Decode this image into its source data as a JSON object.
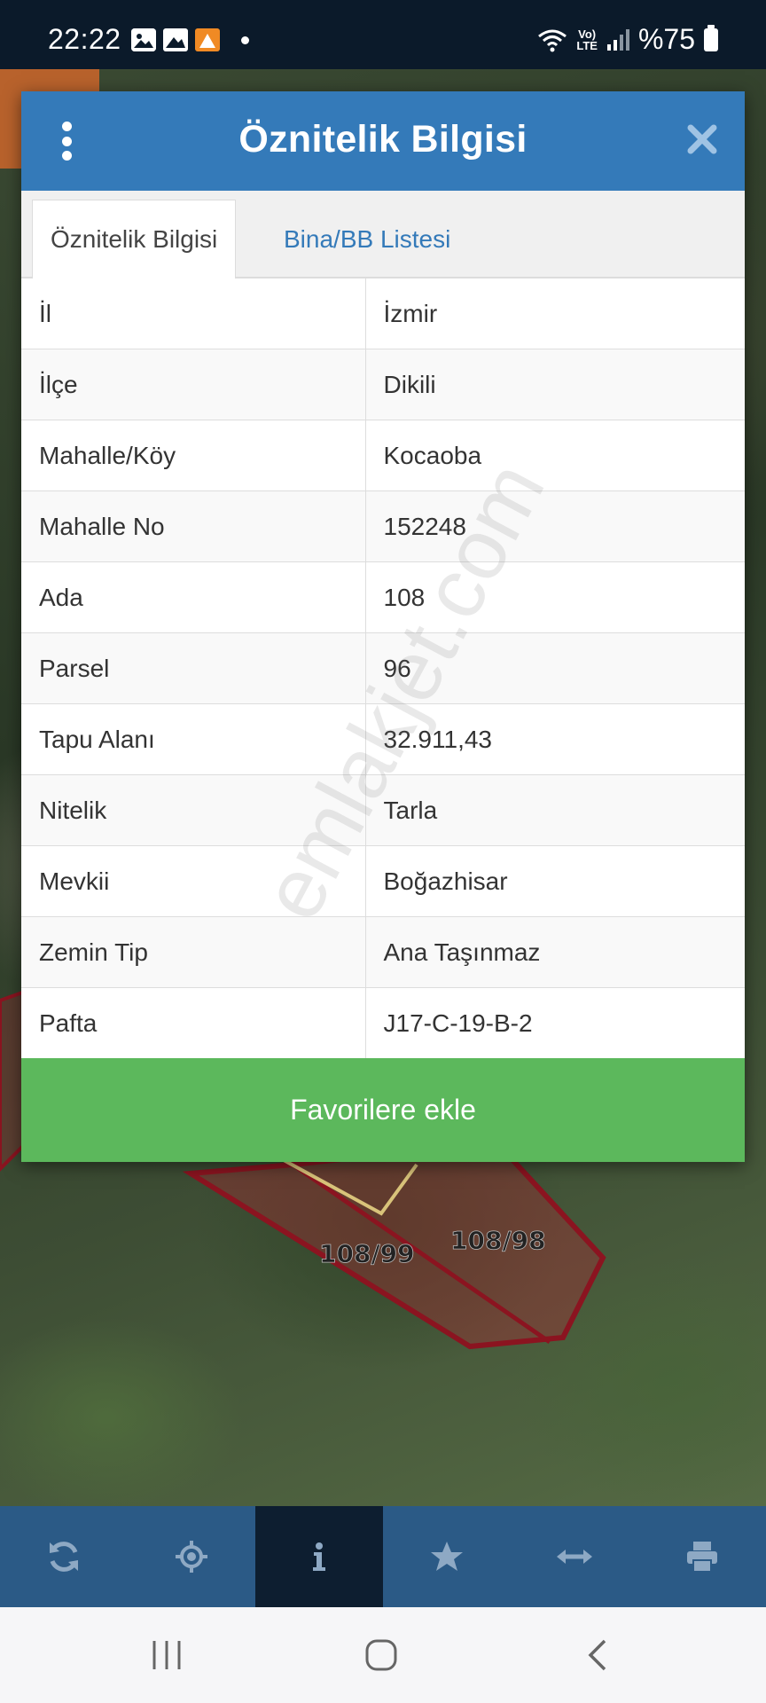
{
  "status_bar": {
    "time": "22:22",
    "lte_top": "Vo)",
    "lte_bottom": "LTE",
    "battery": "%75",
    "icons": [
      "gallery-icon",
      "image-icon",
      "app-icon",
      "notification-dot-icon",
      "wifi-icon",
      "signal-icon",
      "battery-icon"
    ]
  },
  "map": {
    "parcel_labels": [
      "108/99",
      "108/98"
    ]
  },
  "dialog": {
    "title": "Öznitelik Bilgisi",
    "menu_icon": "more-vertical-icon",
    "close_icon": "close-icon",
    "tabs": [
      {
        "label": "Öznitelik Bilgisi",
        "active": true
      },
      {
        "label": "Bina/BB Listesi",
        "active": false
      }
    ],
    "rows": [
      {
        "key": "İl",
        "value": "İzmir"
      },
      {
        "key": "İlçe",
        "value": "Dikili"
      },
      {
        "key": "Mahalle/Köy",
        "value": "Kocaoba"
      },
      {
        "key": "Mahalle No",
        "value": "152248"
      },
      {
        "key": "Ada",
        "value": "108"
      },
      {
        "key": "Parsel",
        "value": "96"
      },
      {
        "key": "Tapu Alanı",
        "value": "32.911,43"
      },
      {
        "key": "Nitelik",
        "value": "Tarla"
      },
      {
        "key": "Mevkii",
        "value": "Boğazhisar"
      },
      {
        "key": "Zemin Tip",
        "value": "Ana Taşınmaz"
      },
      {
        "key": "Pafta",
        "value": "J17-C-19-B-2"
      }
    ],
    "favorite_button": "Favorilere ekle",
    "watermark": "emlakjet.com"
  },
  "toolbar": {
    "items": [
      "refresh-icon",
      "locate-icon",
      "info-icon",
      "star-icon",
      "measure-icon",
      "print-icon"
    ],
    "active_item": "info-icon"
  },
  "navbar": {
    "items": [
      "recent-apps-icon",
      "home-icon",
      "back-icon"
    ]
  },
  "colors": {
    "header_blue": "#347ab9",
    "tab_link_blue": "#347ab9",
    "button_green": "#5cb85c",
    "toolbar_blue": "#2b5a86",
    "toolbar_active": "#0d1e30",
    "parcel_outline": "#8b1420"
  }
}
